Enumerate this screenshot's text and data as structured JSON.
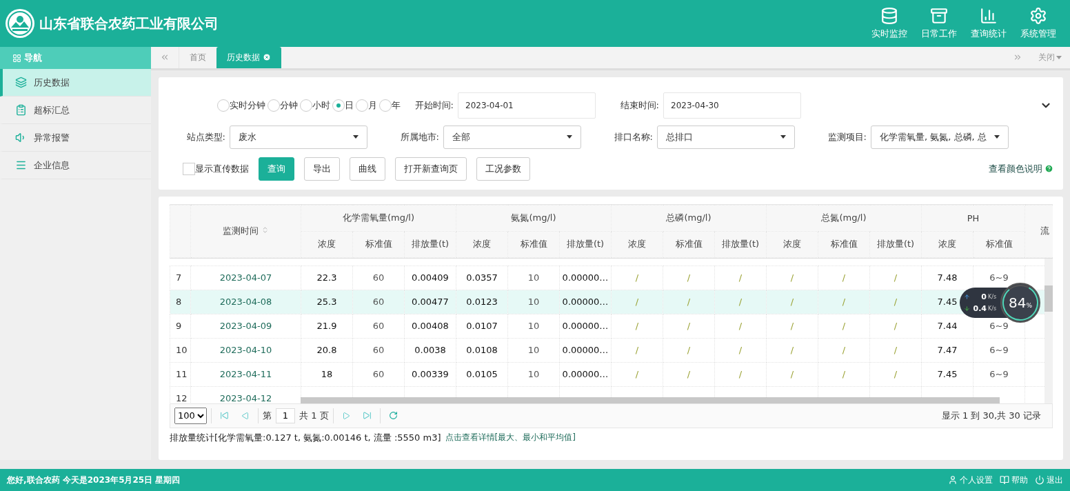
{
  "header": {
    "company": "山东省联合农药工业有限公司",
    "nav": [
      {
        "label": "实时监控",
        "kind": "database"
      },
      {
        "label": "日常工作",
        "kind": "drawer"
      },
      {
        "label": "查询统计",
        "kind": "chart"
      },
      {
        "label": "系统管理",
        "kind": "gears"
      }
    ]
  },
  "sidebar": {
    "title": "导航",
    "items": [
      {
        "label": "历史数据",
        "kind": "layers",
        "selected": true
      },
      {
        "label": "超标汇总",
        "kind": "clipboard",
        "selected": false
      },
      {
        "label": "异常报警",
        "kind": "speaker",
        "selected": false
      },
      {
        "label": "企业信息",
        "kind": "list",
        "selected": false
      }
    ]
  },
  "tabs": {
    "items": [
      {
        "label": "首页",
        "selected": false
      },
      {
        "label": "历史数据",
        "selected": true
      }
    ],
    "close_menu": "关闭"
  },
  "filters": {
    "intervals": [
      {
        "label": "实时分钟",
        "selected": false
      },
      {
        "label": "分钟",
        "selected": false
      },
      {
        "label": "小时",
        "selected": false
      },
      {
        "label": "日",
        "selected": true
      },
      {
        "label": "月",
        "selected": false
      },
      {
        "label": "年",
        "selected": false
      }
    ],
    "start_time": {
      "label": "开始时间:",
      "value": "2023-04-01"
    },
    "end_time": {
      "label": "结束时间:",
      "value": "2023-04-30"
    },
    "selects": [
      {
        "label": "站点类型:",
        "value": "废水"
      },
      {
        "label": "所属地市:",
        "value": "全部"
      },
      {
        "label": "排口名称:",
        "value": "总排口"
      },
      {
        "label": "监测项目:",
        "value": "化学需氧量, 氨氮, 总磷, 总"
      }
    ],
    "show_direct": {
      "label": "显示直传数据",
      "checked": false
    },
    "buttons": [
      {
        "label": "查询",
        "primary": true
      },
      {
        "label": "导出",
        "primary": false
      },
      {
        "label": "曲线",
        "primary": false
      },
      {
        "label": "打开新查询页",
        "primary": false
      },
      {
        "label": "工况参数",
        "primary": false
      }
    ],
    "color_legend": "查看颜色说明"
  },
  "table": {
    "time_column": "监测时间",
    "groups": [
      {
        "name": "化学需氧量(mg/l)",
        "missing": false,
        "columns": [
          "浓度",
          "标准值",
          "排放量(t)"
        ]
      },
      {
        "name": "氨氮(mg/l)",
        "missing": false,
        "columns": [
          "浓度",
          "标准值",
          "排放量(t)"
        ]
      },
      {
        "name": "总磷(mg/l)",
        "missing": true,
        "columns": [
          "浓度",
          "标准值",
          "排放量(t)"
        ]
      },
      {
        "name": "总氮(mg/l)",
        "missing": true,
        "columns": [
          "浓度",
          "标准值",
          "排放量(t)"
        ]
      },
      {
        "name": "PH",
        "missing": false,
        "columns": [
          "浓度",
          "标准值"
        ]
      }
    ],
    "last_column": "流",
    "rows": [
      {
        "index": "7",
        "time": "2023-04-07",
        "selected": false,
        "cells": [
          "22.3",
          "60",
          "0.00409",
          "0.0357",
          "10",
          "0.00000…",
          "/",
          "/",
          "/",
          "/",
          "/",
          "/",
          "7.48",
          "6~9"
        ]
      },
      {
        "index": "8",
        "time": "2023-04-08",
        "selected": true,
        "cells": [
          "25.3",
          "60",
          "0.00477",
          "0.0123",
          "10",
          "0.00000…",
          "/",
          "/",
          "/",
          "/",
          "/",
          "/",
          "7.45"
        ]
      },
      {
        "index": "9",
        "time": "2023-04-09",
        "selected": false,
        "cells": [
          "21.9",
          "60",
          "0.00408",
          "0.0107",
          "10",
          "0.00000…",
          "/",
          "/",
          "/",
          "/",
          "/",
          "/",
          "7.44",
          "6~9"
        ]
      },
      {
        "index": "10",
        "time": "2023-04-10",
        "selected": false,
        "cells": [
          "20.8",
          "60",
          "0.0038",
          "0.0108",
          "10",
          "0.00000…",
          "/",
          "/",
          "/",
          "/",
          "/",
          "/",
          "7.47",
          "6~9"
        ]
      },
      {
        "index": "11",
        "time": "2023-04-11",
        "selected": false,
        "cells": [
          "18",
          "60",
          "0.00339",
          "0.0105",
          "10",
          "0.00000…",
          "/",
          "/",
          "/",
          "/",
          "/",
          "/",
          "7.45",
          "6~9"
        ]
      },
      {
        "index": "12",
        "time": "2023-04-12",
        "selected": false,
        "cells": []
      }
    ]
  },
  "pagination": {
    "page_size": "100",
    "page_prefix": "第",
    "page": "1",
    "page_suffix": "共 1 页",
    "info": "显示 1 到 30,共 30 记录"
  },
  "summary": {
    "text": "排放量统计[化学需氧量:0.127 t, 氨氮:0.00146 t, 流量 :5550 m3]",
    "link": "点击查看详情[最大、最小和平均值]"
  },
  "speed_widget": {
    "upload": "0",
    "upload_unit": "K/s",
    "download": "0.4",
    "download_unit": "K/s",
    "percent": "84",
    "percent_unit": "%"
  },
  "footer": {
    "greeting": "您好,联合农药 今天是2023年5月25日 星期四",
    "links": [
      {
        "label": "个人设置",
        "kind": "user"
      },
      {
        "label": "帮助",
        "kind": "help"
      },
      {
        "label": "退出",
        "kind": "power"
      }
    ]
  }
}
